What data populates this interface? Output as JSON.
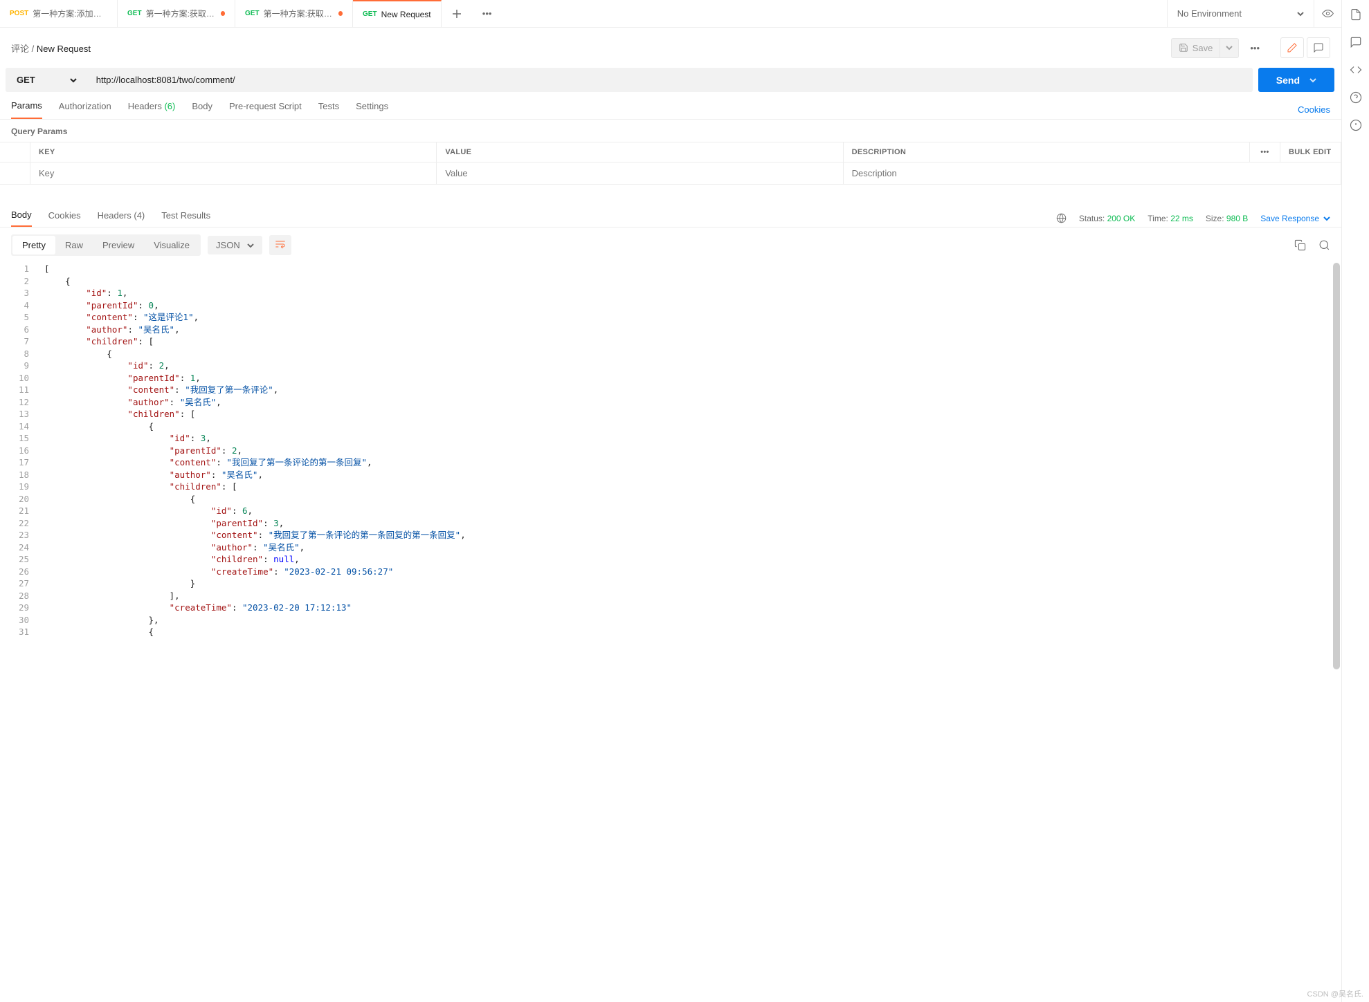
{
  "tabs": [
    {
      "method": "POST",
      "name": "第一种方案:添加评论或者",
      "dirty": false
    },
    {
      "method": "GET",
      "name": "第一种方案:获取评论",
      "dirty": true
    },
    {
      "method": "GET",
      "name": "第一种方案:获取回复",
      "dirty": true
    },
    {
      "method": "GET",
      "name": "New Request",
      "dirty": false,
      "active": true
    }
  ],
  "environment": {
    "label": "No Environment"
  },
  "breadcrumb": {
    "parent": "评论",
    "sep": "/",
    "current": "New Request"
  },
  "toolbar": {
    "save_label": "Save"
  },
  "request": {
    "method": "GET",
    "url": "http://localhost:8081/two/comment/",
    "send_label": "Send"
  },
  "request_tabs": {
    "params": "Params",
    "authorization": "Authorization",
    "headers": "Headers",
    "headers_count": "(6)",
    "body": "Body",
    "prerequest": "Pre-request Script",
    "tests": "Tests",
    "settings": "Settings",
    "cookies": "Cookies"
  },
  "query_params": {
    "title": "Query Params",
    "headers": {
      "key": "KEY",
      "value": "VALUE",
      "description": "DESCRIPTION"
    },
    "bulk_edit": "Bulk Edit",
    "placeholder": {
      "key": "Key",
      "value": "Value",
      "description": "Description"
    }
  },
  "response_tabs": {
    "body": "Body",
    "cookies": "Cookies",
    "headers": "Headers",
    "headers_count": "(4)",
    "test_results": "Test Results"
  },
  "response_meta": {
    "status_label": "Status:",
    "status_value": "200 OK",
    "time_label": "Time:",
    "time_value": "22 ms",
    "size_label": "Size:",
    "size_value": "980 B",
    "save_response": "Save Response"
  },
  "viewmodes": {
    "pretty": "Pretty",
    "raw": "Raw",
    "preview": "Preview",
    "visualize": "Visualize",
    "format": "JSON"
  },
  "response_body": [
    {
      "id": 1,
      "parentId": 0,
      "content": "这是评论1",
      "author": "吴名氏",
      "children": [
        {
          "id": 2,
          "parentId": 1,
          "content": "我回复了第一条评论",
          "author": "吴名氏",
          "children": [
            {
              "id": 3,
              "parentId": 2,
              "content": "我回复了第一条评论的第一条回复",
              "author": "吴名氏",
              "children": [
                {
                  "id": 6,
                  "parentId": 3,
                  "content": "我回复了第一条评论的第一条回复的第一条回复",
                  "author": "吴名氏",
                  "children": null,
                  "createTime": "2023-02-21 09:56:27"
                }
              ],
              "createTime": "2023-02-20 17:12:13"
            }
          ]
        }
      ]
    }
  ],
  "code_lines": [
    "[",
    "    {",
    "        \"id\": 1,",
    "        \"parentId\": 0,",
    "        \"content\": \"这是评论1\",",
    "        \"author\": \"吴名氏\",",
    "        \"children\": [",
    "            {",
    "                \"id\": 2,",
    "                \"parentId\": 1,",
    "                \"content\": \"我回复了第一条评论\",",
    "                \"author\": \"吴名氏\",",
    "                \"children\": [",
    "                    {",
    "                        \"id\": 3,",
    "                        \"parentId\": 2,",
    "                        \"content\": \"我回复了第一条评论的第一条回复\",",
    "                        \"author\": \"吴名氏\",",
    "                        \"children\": [",
    "                            {",
    "                                \"id\": 6,",
    "                                \"parentId\": 3,",
    "                                \"content\": \"我回复了第一条评论的第一条回复的第一条回复\",",
    "                                \"author\": \"吴名氏\",",
    "                                \"children\": null,",
    "                                \"createTime\": \"2023-02-21 09:56:27\"",
    "                            }",
    "                        ],",
    "                        \"createTime\": \"2023-02-20 17:12:13\"",
    "                    },",
    "                    {"
  ],
  "watermark": "CSDN @吴名氏."
}
